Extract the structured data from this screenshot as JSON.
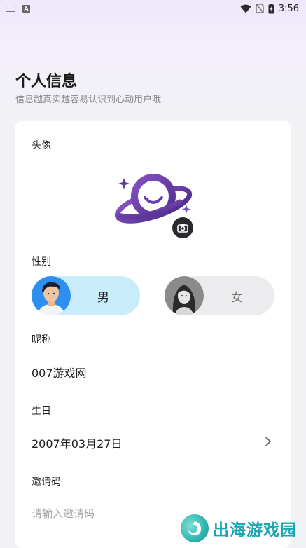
{
  "status_bar": {
    "time": "3:56",
    "left_icons": [
      "keyboard-icon",
      "a-notification-icon"
    ],
    "right_icons": [
      "wifi-icon",
      "no-sim-icon",
      "battery-icon"
    ],
    "a_icon_letter": "A"
  },
  "header": {
    "title": "个人信息",
    "subtitle": "信息越真实越容易认识到心动用户哦"
  },
  "form": {
    "avatar_label": "头像",
    "gender_label": "性别",
    "gender_options": [
      {
        "label": "男",
        "selected": true
      },
      {
        "label": "女",
        "selected": false
      }
    ],
    "nickname_label": "昵称",
    "nickname_value": "007游戏网",
    "birthday_label": "生日",
    "birthday_value": "2007年03月27日",
    "invite_label": "邀请码",
    "invite_placeholder": "请输入邀请码"
  },
  "watermark": {
    "text": "出海游戏园"
  },
  "colors": {
    "accent_purple": "#6b3fb8",
    "male_selected_bg": "#c9ecfb",
    "female_bg": "#ececef",
    "watermark_teal": "#1aa7b4"
  }
}
